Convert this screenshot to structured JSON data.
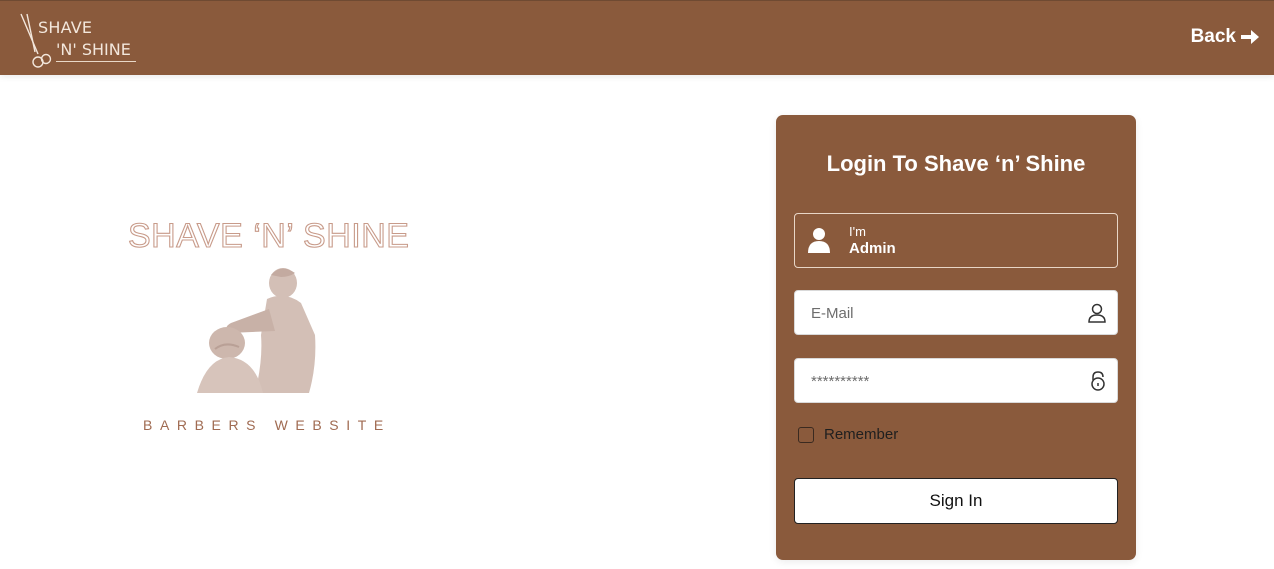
{
  "header": {
    "logo_line1": "SHAVE",
    "logo_line2": "'N' SHINE",
    "back_label": "Back"
  },
  "hero": {
    "title": "SHAVE ‘N’ SHINE",
    "subtitle": "BARBERS WEBSITE"
  },
  "login": {
    "title": "Login To Shave ‘n’ Shine",
    "role_label": "I'm",
    "role_value": "Admin",
    "email_placeholder": "E-Mail",
    "password_placeholder": "**********",
    "remember_label": "Remember",
    "signin_label": "Sign In"
  },
  "colors": {
    "brand": "#8a5a3c",
    "hero_outline": "#c89b8a",
    "hero_sub": "#a06b52"
  },
  "icons": {
    "logo": "scissors-icon",
    "back": "arrow-right-icon",
    "role": "user-solid-icon",
    "email": "user-outline-icon",
    "password": "lock-icon"
  }
}
